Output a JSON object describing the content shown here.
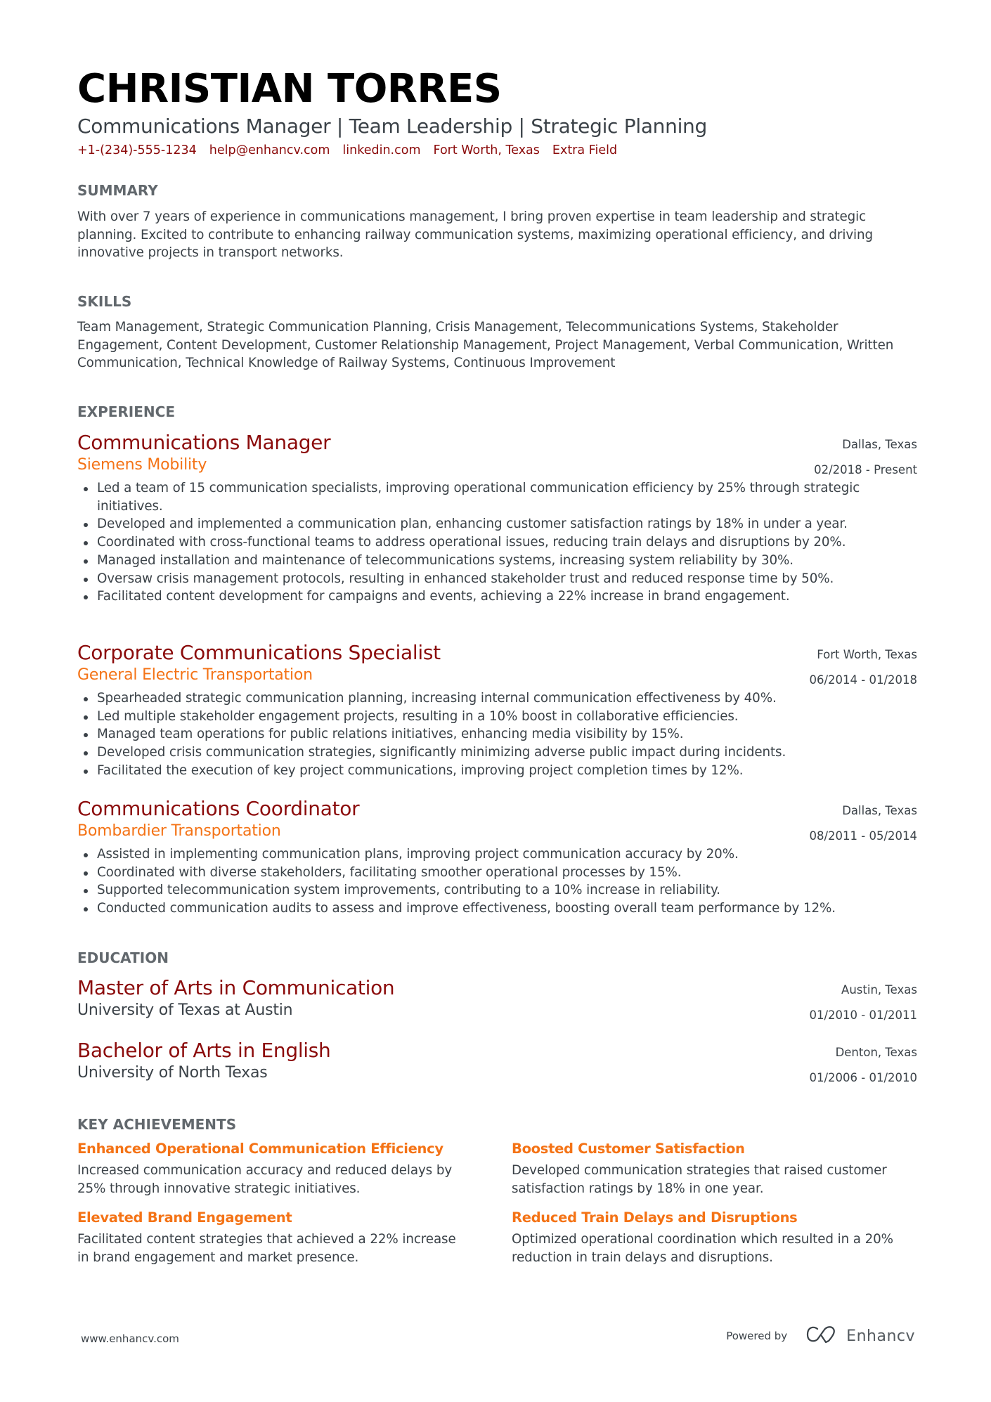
{
  "header": {
    "name": "CHRISTIAN TORRES",
    "headline": "Communications Manager | Team Leadership | Strategic Planning",
    "contacts": {
      "phone": "+1-(234)-555-1234",
      "email": "help@enhancv.com",
      "linkedin": "linkedin.com",
      "location": "Fort Worth, Texas",
      "extra": "Extra Field"
    }
  },
  "summary": {
    "title": "SUMMARY",
    "text": "With over 7 years of experience in communications management, I bring proven expertise in team leadership and strategic planning. Excited to contribute to enhancing railway communication systems, maximizing operational efficiency, and driving innovative projects in transport networks."
  },
  "skills": {
    "title": "SKILLS",
    "text": "Team Management, Strategic Communication Planning, Crisis Management, Telecommunications Systems, Stakeholder Engagement, Content Development, Customer Relationship Management, Project Management, Verbal Communication, Written Communication, Technical Knowledge of Railway Systems, Continuous Improvement"
  },
  "experience": {
    "title": "EXPERIENCE",
    "jobs": [
      {
        "role": "Communications Manager",
        "company": "Siemens Mobility",
        "location": "Dallas, Texas",
        "dates": "02/2018 - Present",
        "bullets": [
          "Led a team of 15 communication specialists, improving operational communication efficiency by 25% through strategic initiatives.",
          "Developed and implemented a communication plan, enhancing customer satisfaction ratings by 18% in under a year.",
          "Coordinated with cross-functional teams to address operational issues, reducing train delays and disruptions by 20%.",
          "Managed installation and maintenance of telecommunications systems, increasing system reliability by 30%.",
          "Oversaw crisis management protocols, resulting in enhanced stakeholder trust and reduced response time by 50%.",
          "Facilitated content development for campaigns and events, achieving a 22% increase in brand engagement."
        ]
      },
      {
        "role": "Corporate Communications Specialist",
        "company": "General Electric Transportation",
        "location": "Fort Worth, Texas",
        "dates": "06/2014 - 01/2018",
        "bullets": [
          "Spearheaded strategic communication planning, increasing internal communication effectiveness by 40%.",
          "Led multiple stakeholder engagement projects, resulting in a 10% boost in collaborative efficiencies.",
          "Managed team operations for public relations initiatives, enhancing media visibility by 15%.",
          "Developed crisis communication strategies, significantly minimizing adverse public impact during incidents.",
          "Facilitated the execution of key project communications, improving project completion times by 12%."
        ]
      },
      {
        "role": "Communications Coordinator",
        "company": "Bombardier Transportation",
        "location": "Dallas, Texas",
        "dates": "08/2011 - 05/2014",
        "bullets": [
          "Assisted in implementing communication plans, improving project communication accuracy by 20%.",
          "Coordinated with diverse stakeholders, facilitating smoother operational processes by 15%.",
          "Supported telecommunication system improvements, contributing to a 10% increase in reliability.",
          "Conducted communication audits to assess and improve effectiveness, boosting overall team performance by 12%."
        ]
      }
    ]
  },
  "education": {
    "title": "EDUCATION",
    "items": [
      {
        "degree": "Master of Arts in Communication",
        "school": "University of Texas at Austin",
        "location": "Austin, Texas",
        "dates": "01/2010 - 01/2011"
      },
      {
        "degree": "Bachelor of Arts in English",
        "school": "University of North Texas",
        "location": "Denton, Texas",
        "dates": "01/2006 - 01/2010"
      }
    ]
  },
  "achievements": {
    "title": "KEY ACHIEVEMENTS",
    "items": [
      {
        "title": "Enhanced Operational Communication Efficiency",
        "text": "Increased communication accuracy and reduced delays by 25% through innovative strategic initiatives."
      },
      {
        "title": "Boosted Customer Satisfaction",
        "text": "Developed communication strategies that raised customer satisfaction ratings by 18% in one year."
      },
      {
        "title": "Elevated Brand Engagement",
        "text": "Facilitated content strategies that achieved a 22% increase in brand engagement and market presence."
      },
      {
        "title": "Reduced Train Delays and Disruptions",
        "text": "Optimized operational coordination which resulted in a 20% reduction in train delays and disruptions."
      }
    ]
  },
  "footer": {
    "website": "www.enhancv.com",
    "powered_by": "Powered by",
    "brand": "Enhancv",
    "brand_icon": "enhancv-logo-icon"
  },
  "colors": {
    "accent_dark_red": "#8b0b0b",
    "accent_orange": "#f47316",
    "text": "#3b4248",
    "section_title": "#62686d",
    "name": "#000000"
  }
}
